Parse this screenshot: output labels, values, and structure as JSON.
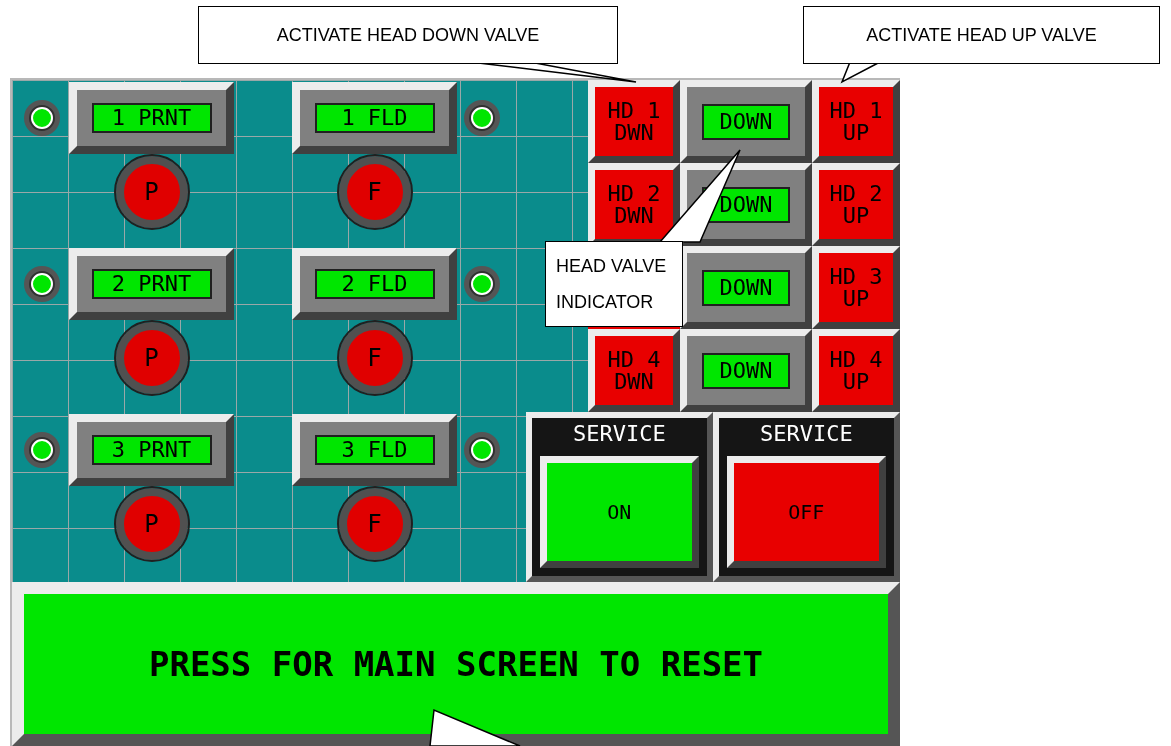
{
  "callouts": [
    {
      "text": "ACTIVATE HEAD DOWN VALVE"
    },
    {
      "text": "ACTIVATE HEAD UP VALVE"
    },
    {
      "text": "HEAD VALVE INDICATOR"
    }
  ],
  "stations": [
    {
      "print_lamp_on": true,
      "print_label": "1 PRNT",
      "print_button": "P",
      "fold_label": "1 FLD",
      "fold_button": "F",
      "fold_lamp_on": true
    },
    {
      "print_lamp_on": true,
      "print_label": "2 PRNT",
      "print_button": "P",
      "fold_label": "2 FLD",
      "fold_button": "F",
      "fold_lamp_on": true
    },
    {
      "print_lamp_on": true,
      "print_label": "3 PRNT",
      "print_button": "P",
      "fold_label": "3 FLD",
      "fold_button": "F",
      "fold_lamp_on": true
    }
  ],
  "valves": [
    {
      "down_button": "HD 1 DWN",
      "indicator": "DOWN",
      "up_button": "HD 1 UP"
    },
    {
      "down_button": "HD 2 DWN",
      "indicator": "DOWN",
      "up_button": "HD 2 UP"
    },
    {
      "indicator": "DOWN",
      "up_button": "HD 3 UP"
    },
    {
      "down_button": "HD 4 DWN",
      "indicator": "DOWN",
      "up_button": "HD 4 UP"
    }
  ],
  "service": [
    {
      "title": "SERVICE",
      "button": "ON",
      "kind": "on"
    },
    {
      "title": "SERVICE",
      "button": "OFF",
      "kind": "off"
    }
  ],
  "main_button": "PRESS FOR MAIN SCREEN TO RESET"
}
